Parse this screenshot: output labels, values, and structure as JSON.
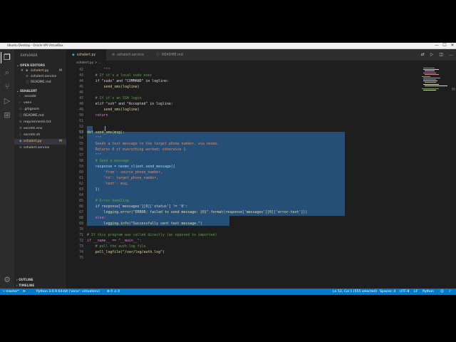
{
  "window": {
    "title": "Ubuntu Desktop - Oracle VM VirtualBox",
    "controls": [
      "—",
      "☐",
      "✕"
    ]
  },
  "activity_bar": {
    "icons": [
      "files-icon",
      "search-icon",
      "source-control-icon",
      "run-debug-icon",
      "extensions-icon",
      "settings-gear-icon"
    ]
  },
  "sidebar": {
    "title": "EXPLORER",
    "open_editors_header": "OPEN EDITORS",
    "open_editors": [
      {
        "name": "sshalert.py",
        "marker": "M",
        "close": "✕"
      },
      {
        "name": "sshalert.service",
        "marker": ""
      },
      {
        "name": "README.md",
        "marker": ""
      }
    ],
    "project_header": "SSHALERT",
    "files": [
      {
        "name": ".vscode",
        "type": "folder",
        "marker": ""
      },
      {
        "name": "venv",
        "type": "folder",
        "marker": ""
      },
      {
        "name": ".gitignore",
        "type": "file",
        "marker": ""
      },
      {
        "name": "README.md",
        "type": "file",
        "marker": ""
      },
      {
        "name": "requirements.txt",
        "type": "file",
        "marker": ""
      },
      {
        "name": "secrets.env",
        "type": "file",
        "marker": ""
      },
      {
        "name": "secrets.sh",
        "type": "file",
        "marker": ""
      },
      {
        "name": "sshalert.py",
        "type": "file",
        "marker": "M"
      },
      {
        "name": "sshalert.service",
        "type": "file",
        "marker": ""
      }
    ],
    "outline_header": "OUTLINE",
    "timeline_header": "TIMELINE"
  },
  "tabs": [
    {
      "label": "sshalert.py",
      "active": true,
      "marker": "M"
    },
    {
      "label": "sshalert.service",
      "active": false,
      "marker": ""
    },
    {
      "label": "README.md",
      "active": false,
      "marker": ""
    }
  ],
  "breadcrumb": "sshalert.py > ...",
  "editor": {
    "lines": [
      {
        "n": "42",
        "text": "        \"\"\""
      },
      {
        "n": "43",
        "text": "    # If it's a local sudo exec"
      },
      {
        "n": "44",
        "text": "    if \"sudo\" and \"COMMAND\" in logline:"
      },
      {
        "n": "45",
        "text": "        send_sms(logline)"
      },
      {
        "n": "46",
        "text": ""
      },
      {
        "n": "47",
        "text": "    # If it's an SSH login"
      },
      {
        "n": "48",
        "text": "    elif \"ssh\" and \"Accepted\" in logline:"
      },
      {
        "n": "49",
        "text": "        send_sms(logline)"
      },
      {
        "n": "50",
        "text": "    return"
      },
      {
        "n": "51",
        "text": ""
      },
      {
        "n": "52",
        "text": ""
      },
      {
        "n": "53",
        "text": "def send_sms(msg):"
      },
      {
        "n": "54",
        "text": "    \"\"\""
      },
      {
        "n": "55",
        "text": "    Sends a text message to the target phone number, via nexmo."
      },
      {
        "n": "56",
        "text": "    Returns 0 if everything worked; otherwise 1"
      },
      {
        "n": "57",
        "text": "    \"\"\""
      },
      {
        "n": "58",
        "text": "    # Send a message"
      },
      {
        "n": "59",
        "text": "    response = nexmo_client.send_message({"
      },
      {
        "n": "60",
        "text": "        'from': source_phone_number,"
      },
      {
        "n": "61",
        "text": "        'to': target_phone_number,"
      },
      {
        "n": "62",
        "text": "        'text': msg,"
      },
      {
        "n": "63",
        "text": "    })"
      },
      {
        "n": "64",
        "text": ""
      },
      {
        "n": "65",
        "text": "    # Error handling"
      },
      {
        "n": "66",
        "text": "    if response['messages'][0]['status'] != '0':"
      },
      {
        "n": "67",
        "text": "        logging.error(\"ERROR: failed to send message: {0}\".format(response['messages'][0]['error-text']))"
      },
      {
        "n": "68",
        "text": "    else:"
      },
      {
        "n": "69",
        "text": "        logging.info(\"Successfully sent text message.\")"
      },
      {
        "n": "70",
        "text": ""
      },
      {
        "n": "71",
        "text": "# If this program was called directly (as opposed to imported)"
      },
      {
        "n": "72",
        "text": "if __name__ == \"__main__\":"
      },
      {
        "n": "73",
        "text": "    # poll the auth.log file"
      },
      {
        "n": "74",
        "text": "    poll_logfile(\"/var/log/auth.log\")"
      },
      {
        "n": "75",
        "text": ""
      }
    ]
  },
  "statusbar": {
    "branch": "master*",
    "sync": "⟳",
    "errors": "⊗ 0 ⚠ 0",
    "interpreter": "Python 3.6.9 64-bit ('venv': virtualenv)",
    "cursor": "Ln 52, Col 1 (555 selected)",
    "spaces": "Spaces: 4",
    "encoding": "UTF-8",
    "eol": "LF",
    "language": "Python",
    "feedback_icon": "feedback-icon",
    "bell_icon": "bell-icon"
  },
  "colors": {
    "accent": "#007acc",
    "selection": "#264f78",
    "editor_bg": "#1e1e1e",
    "sidebar_bg": "#252526",
    "modified": "#e2c08d"
  }
}
